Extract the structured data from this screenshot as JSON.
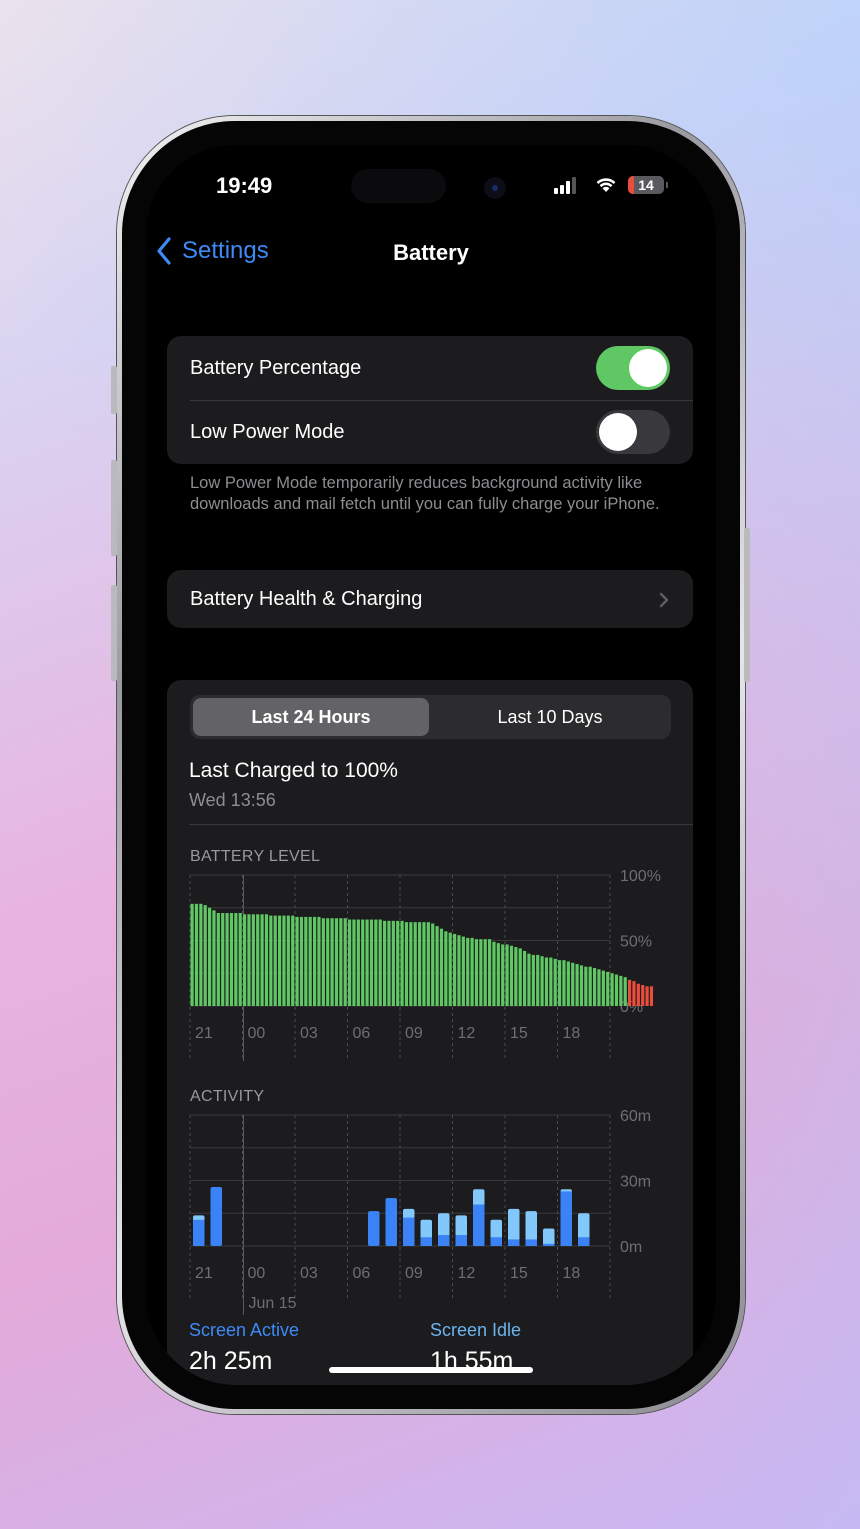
{
  "status_bar": {
    "time": "19:49",
    "battery_percent": "14",
    "icons": [
      "cellular-signal-icon",
      "wifi-icon",
      "battery-icon"
    ]
  },
  "nav": {
    "back_label": "Settings",
    "title": "Battery"
  },
  "settings_group": {
    "battery_percentage": {
      "label": "Battery Percentage",
      "on": true
    },
    "low_power_mode": {
      "label": "Low Power Mode",
      "on": false
    },
    "footnote": "Low Power Mode temporarily reduces background activity like downloads and mail fetch until you can fully charge your iPhone."
  },
  "health_row": {
    "label": "Battery Health & Charging"
  },
  "usage": {
    "segments": [
      {
        "label": "Last 24 Hours",
        "selected": true
      },
      {
        "label": "Last 10 Days",
        "selected": false
      }
    ],
    "last_charged_title": "Last Charged to 100%",
    "last_charged_time": "Wed 13:56"
  },
  "stats": {
    "screen_active": {
      "label": "Screen Active",
      "value": "2h 25m"
    },
    "screen_idle": {
      "label": "Screen Idle",
      "value": "1h 55m"
    }
  },
  "colors": {
    "accent_blue": "#3d8af7",
    "toggle_on": "#5fc864",
    "battery_green": "#5fc864",
    "battery_low_red": "#eb4d3d",
    "activity_active": "#3a82f6",
    "activity_idle": "#82c8fa",
    "idle_label": "#6ab4f0"
  },
  "chart_data": [
    {
      "type": "bar",
      "title": "BATTERY LEVEL",
      "x_tick_labels": [
        "21",
        "00",
        "03",
        "06",
        "09",
        "12",
        "15",
        "18"
      ],
      "y_tick_labels": [
        "100%",
        "50%",
        "0%"
      ],
      "ylim": [
        0,
        100
      ],
      "unit": "%",
      "grid": true,
      "low_threshold": 20,
      "x_interval_minutes": 15,
      "values": [
        78,
        78,
        78,
        77,
        75,
        73,
        71,
        71,
        71,
        71,
        71,
        71,
        70,
        70,
        70,
        70,
        70,
        70,
        69,
        69,
        69,
        69,
        69,
        69,
        68,
        68,
        68,
        68,
        68,
        68,
        67,
        67,
        67,
        67,
        67,
        67,
        66,
        66,
        66,
        66,
        66,
        66,
        66,
        66,
        65,
        65,
        65,
        65,
        65,
        64,
        64,
        64,
        64,
        64,
        64,
        63,
        61,
        59,
        57,
        56,
        55,
        54,
        53,
        52,
        52,
        51,
        51,
        51,
        51,
        49,
        48,
        47,
        47,
        46,
        45,
        44,
        42,
        40,
        39,
        39,
        38,
        37,
        37,
        36,
        35,
        35,
        34,
        33,
        32,
        31,
        30,
        30,
        29,
        28,
        27,
        26,
        25,
        24,
        23,
        22,
        20,
        19,
        17,
        16,
        15,
        15
      ]
    },
    {
      "type": "bar",
      "stacked": true,
      "title": "ACTIVITY",
      "x_tick_labels": [
        "21",
        "00",
        "03",
        "06",
        "09",
        "12",
        "15",
        "18"
      ],
      "date_label": "Jun 15",
      "y_tick_labels": [
        "60m",
        "30m",
        "0m"
      ],
      "ylim": [
        0,
        60
      ],
      "unit": "minutes",
      "grid": true,
      "hours": [
        21,
        22,
        23,
        0,
        1,
        2,
        3,
        4,
        5,
        6,
        7,
        8,
        9,
        10,
        11,
        12,
        13,
        14,
        15,
        16,
        17,
        18,
        19
      ],
      "series": [
        {
          "name": "Screen Active",
          "values": [
            12,
            27,
            0,
            0,
            0,
            0,
            0,
            0,
            0,
            0,
            16,
            22,
            13,
            4,
            5,
            5,
            19,
            4,
            3,
            3,
            1,
            25,
            4
          ]
        },
        {
          "name": "Screen Idle",
          "values": [
            2,
            0,
            0,
            0,
            0,
            0,
            0,
            0,
            0,
            0,
            0,
            0,
            4,
            8,
            10,
            9,
            7,
            8,
            14,
            13,
            7,
            1,
            11
          ]
        }
      ]
    }
  ]
}
